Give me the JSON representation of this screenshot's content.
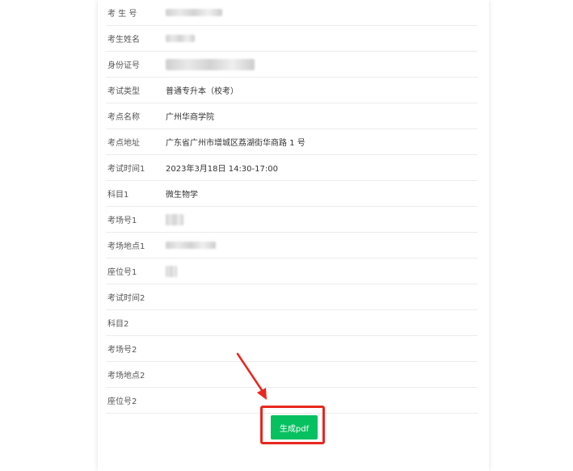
{
  "fields": [
    {
      "label": "考 生 号",
      "value": ""
    },
    {
      "label": "考生姓名",
      "value": ""
    },
    {
      "label": "身份证号",
      "value": ""
    },
    {
      "label": "考试类型",
      "value": "普通专升本（校考）"
    },
    {
      "label": "考点名称",
      "value": "广州华商学院"
    },
    {
      "label": "考点地址",
      "value": "广东省广州市增城区荔湖街华商路 1 号"
    },
    {
      "label": "考试时间1",
      "value": "2023年3月18日 14:30-17:00"
    },
    {
      "label": "科目1",
      "value": "微生物学"
    },
    {
      "label": "考场号1",
      "value": ""
    },
    {
      "label": "考场地点1",
      "value": ""
    },
    {
      "label": "座位号1",
      "value": ""
    },
    {
      "label": "考试时间2",
      "value": ""
    },
    {
      "label": "科目2",
      "value": ""
    },
    {
      "label": "考场号2",
      "value": ""
    },
    {
      "label": "考场地点2",
      "value": ""
    },
    {
      "label": "座位号2",
      "value": ""
    }
  ],
  "actions": {
    "generate_pdf_label": "生成pdf"
  },
  "colors": {
    "button": "#07c160",
    "highlight": "#e8281e"
  }
}
